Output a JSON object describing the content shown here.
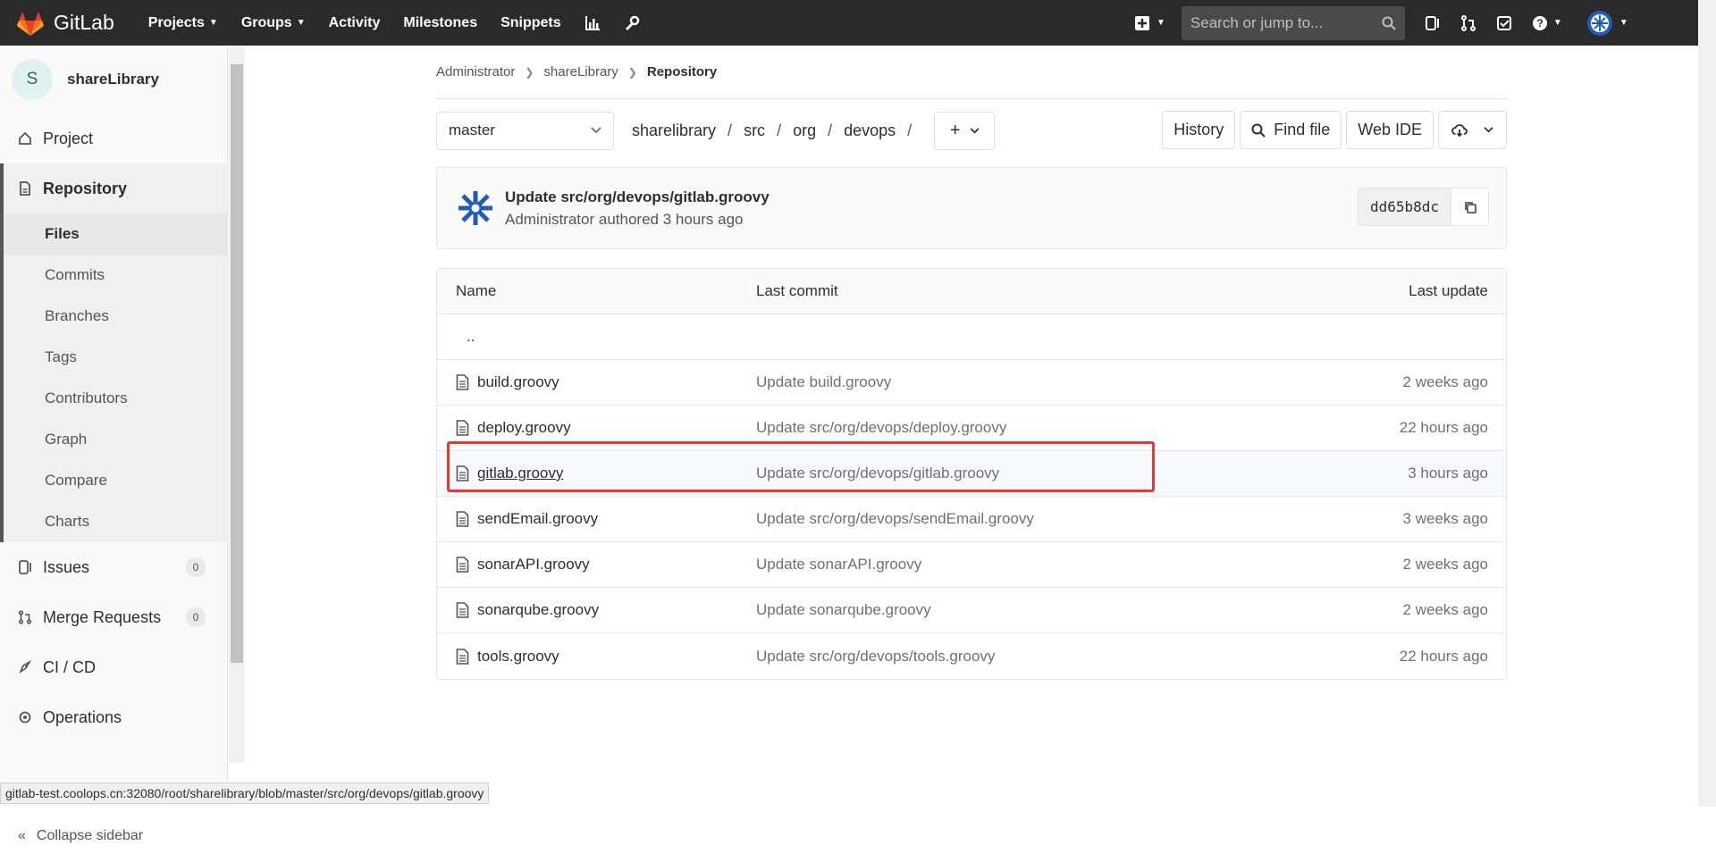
{
  "navbar": {
    "brand": "GitLab",
    "links": [
      {
        "label": "Projects",
        "has_caret": true
      },
      {
        "label": "Groups",
        "has_caret": true
      },
      {
        "label": "Activity",
        "has_caret": false
      },
      {
        "label": "Milestones",
        "has_caret": false
      },
      {
        "label": "Snippets",
        "has_caret": false
      }
    ],
    "search_placeholder": "Search or jump to..."
  },
  "sidebar": {
    "project_initial": "S",
    "project_name": "shareLibrary",
    "items": {
      "project": "Project",
      "repository": "Repository",
      "issues": "Issues",
      "issues_count": "0",
      "merge_requests": "Merge Requests",
      "merge_requests_count": "0",
      "cicd": "CI / CD",
      "operations": "Operations"
    },
    "repo_sub": [
      "Files",
      "Commits",
      "Branches",
      "Tags",
      "Contributors",
      "Graph",
      "Compare",
      "Charts"
    ],
    "collapse": "Collapse sidebar"
  },
  "breadcrumb": [
    "Administrator",
    "shareLibrary",
    "Repository"
  ],
  "toolbar": {
    "branch": "master",
    "path": [
      "sharelibrary",
      "src",
      "org",
      "devops"
    ],
    "history": "History",
    "find_file": "Find file",
    "web_ide": "Web IDE"
  },
  "last_commit": {
    "title": "Update src/org/devops/gitlab.groovy",
    "meta": "Administrator authored 3 hours ago",
    "sha": "dd65b8dc"
  },
  "table": {
    "headers": [
      "Name",
      "Last commit",
      "Last update"
    ],
    "updir": "..",
    "rows": [
      {
        "name": "build.groovy",
        "commit": "Update build.groovy",
        "updated": "2 weeks ago"
      },
      {
        "name": "deploy.groovy",
        "commit": "Update src/org/devops/deploy.groovy",
        "updated": "22 hours ago"
      },
      {
        "name": "gitlab.groovy",
        "commit": "Update src/org/devops/gitlab.groovy",
        "updated": "3 hours ago"
      },
      {
        "name": "sendEmail.groovy",
        "commit": "Update src/org/devops/sendEmail.groovy",
        "updated": "3 weeks ago"
      },
      {
        "name": "sonarAPI.groovy",
        "commit": "Update sonarAPI.groovy",
        "updated": "2 weeks ago"
      },
      {
        "name": "sonarqube.groovy",
        "commit": "Update sonarqube.groovy",
        "updated": "2 weeks ago"
      },
      {
        "name": "tools.groovy",
        "commit": "Update src/org/devops/tools.groovy",
        "updated": "22 hours ago"
      }
    ]
  },
  "status_url": "gitlab-test.coolops.cn:32080/root/sharelibrary/blob/master/src/org/devops/gitlab.groovy",
  "colors": {
    "navbar": "#2a2a2a",
    "highlight": "#e53935",
    "accent": "#fc6d26"
  }
}
